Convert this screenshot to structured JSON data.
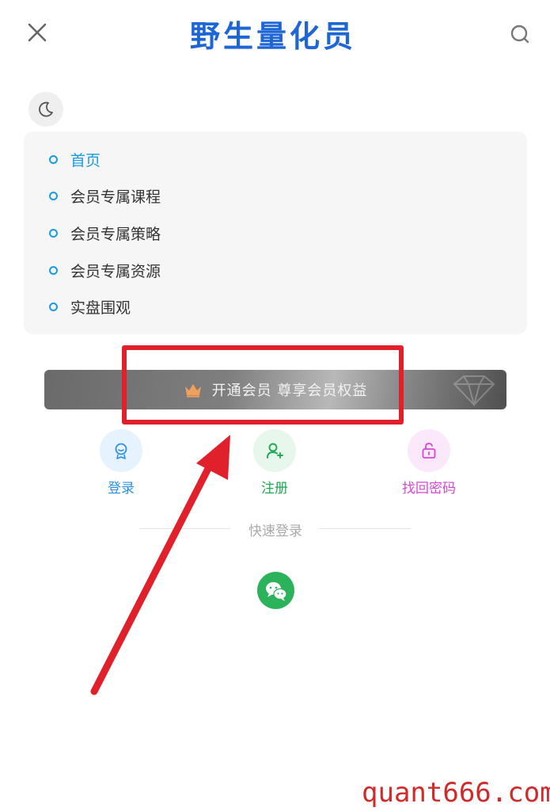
{
  "header": {
    "brand_name": "野生量化员",
    "icons": {
      "close": "close-icon",
      "search": "search-icon"
    }
  },
  "theme": {
    "icon": "moon-icon"
  },
  "nav": {
    "items": [
      {
        "label": "首页",
        "active": true
      },
      {
        "label": "会员专属课程",
        "active": false
      },
      {
        "label": "会员专属策略",
        "active": false
      },
      {
        "label": "会员专属资源",
        "active": false
      },
      {
        "label": "实盘围观",
        "active": false
      }
    ],
    "active_color": "#1a9ae0"
  },
  "vip": {
    "label": "开通会员 尊享会员权益",
    "icon": "crown-icon",
    "crown_color": "#f0a05a"
  },
  "actions": {
    "login": {
      "label": "登录",
      "icon": "badge-icon",
      "color": "#2f8fde"
    },
    "register": {
      "label": "注册",
      "icon": "add-user-icon",
      "color": "#1ea952"
    },
    "reset": {
      "label": "找回密码",
      "icon": "lock-icon",
      "color": "#d746d7"
    }
  },
  "quick_login": {
    "title": "快速登录",
    "wechat_icon": "wechat-icon",
    "wechat_color": "#2bb25a"
  },
  "annotation": {
    "box_color": "#e0202a",
    "arrow_color": "#e0202a"
  },
  "watermark": {
    "text": "quant666.com",
    "color": "#d12a2a"
  }
}
